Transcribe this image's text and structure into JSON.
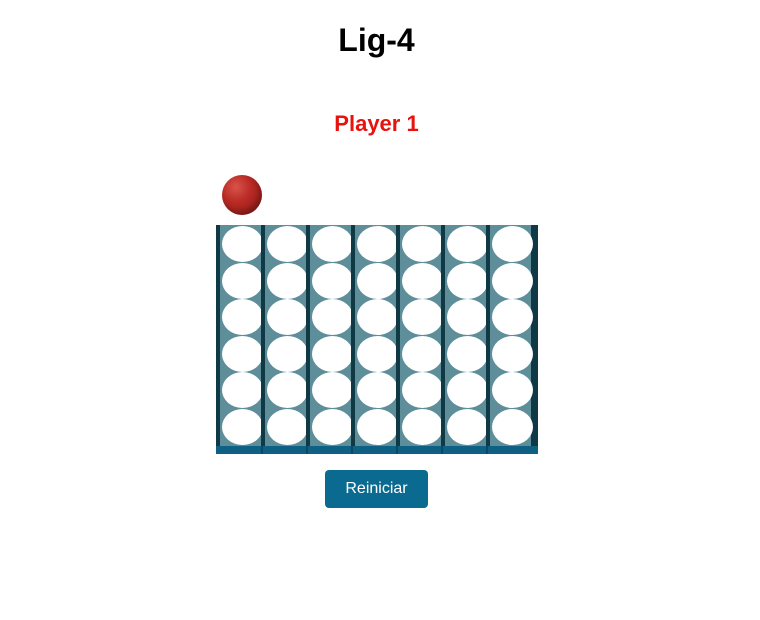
{
  "game": {
    "title": "Lig-4",
    "current_player": "Player 1",
    "current_player_color": "#e8130f",
    "next_piece_color": "#b92a25",
    "restart_label": "Reiniciar",
    "button_color": "#0b6a8f",
    "board_color": "#5e8e99",
    "columns": 7,
    "rows": 6,
    "cells": [
      [
        "empty",
        "empty",
        "empty",
        "empty",
        "empty",
        "empty",
        "empty"
      ],
      [
        "empty",
        "empty",
        "empty",
        "empty",
        "empty",
        "empty",
        "empty"
      ],
      [
        "empty",
        "empty",
        "empty",
        "empty",
        "empty",
        "empty",
        "empty"
      ],
      [
        "empty",
        "empty",
        "empty",
        "empty",
        "empty",
        "empty",
        "empty"
      ],
      [
        "empty",
        "empty",
        "empty",
        "empty",
        "empty",
        "empty",
        "empty"
      ],
      [
        "empty",
        "empty",
        "empty",
        "empty",
        "empty",
        "empty",
        "empty"
      ]
    ]
  }
}
